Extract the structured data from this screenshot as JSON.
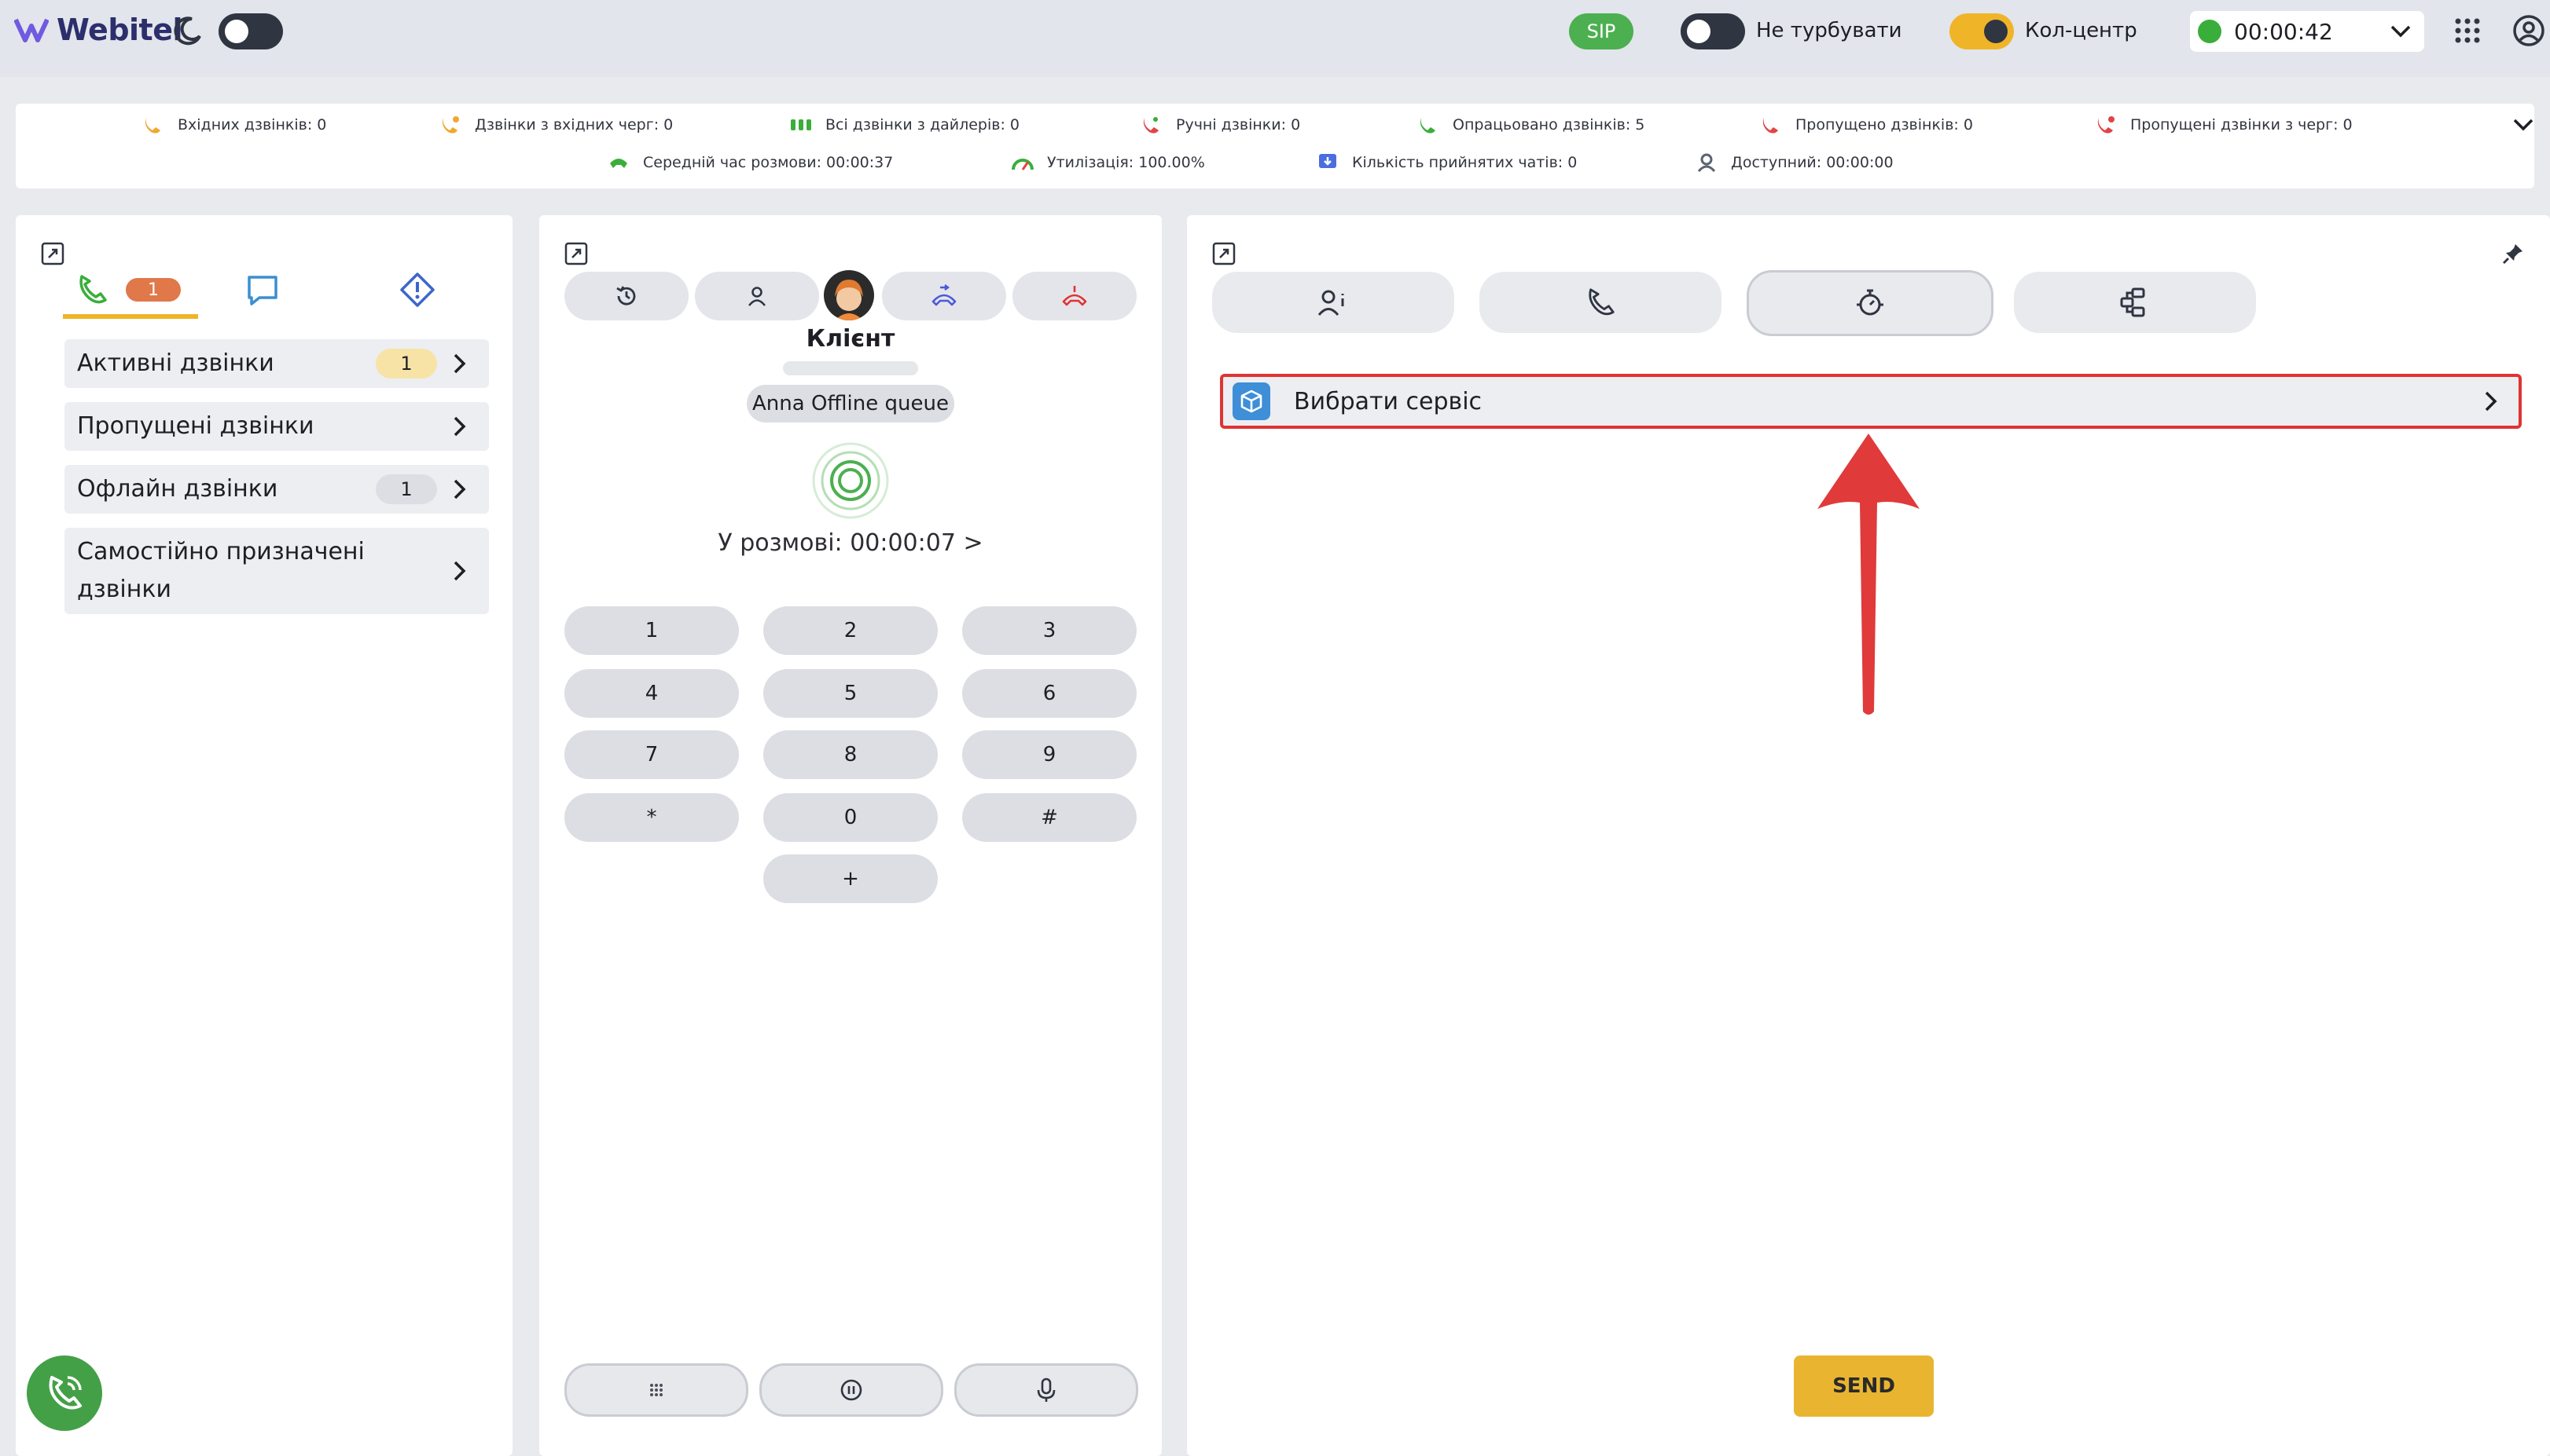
{
  "header": {
    "logo_text": "Webitel",
    "sip_label": "SIP",
    "dnd_label": "Не турбувати",
    "callcenter_label": "Кол-центр",
    "status_timer": "00:00:42"
  },
  "stats": [
    {
      "label": "Вхідних дзвінків: 0"
    },
    {
      "label": "Дзвінки з вхідних черг: 0"
    },
    {
      "label": "Всі дзвінки з дайлерів: 0"
    },
    {
      "label": "Ручні дзвінки: 0"
    },
    {
      "label": "Опрацьовано дзвінків: 5"
    },
    {
      "label": "Пропущено дзвінків: 0"
    },
    {
      "label": "Пропущені дзвінки з черг: 0"
    },
    {
      "label": "Середній час розмови: 00:00:37"
    },
    {
      "label": "Утилізація: 100.00%"
    },
    {
      "label": "Кількість прийнятих чатів: 0"
    },
    {
      "label": "Доступний: 00:00:00"
    }
  ],
  "left": {
    "calls_tab_badge": "1",
    "items": [
      {
        "label": "Активні дзвінки",
        "badge": "1"
      },
      {
        "label": "Пропущені дзвінки",
        "badge": ""
      },
      {
        "label": "Офлайн дзвінки",
        "badge": "1"
      },
      {
        "label": "Самостійно призначені дзвінки",
        "badge": ""
      }
    ]
  },
  "mid": {
    "contact_name": "Клієнт",
    "queue_name": "Anna Offline queue",
    "call_status": "У розмові: 00:00:07 >",
    "keys": [
      "1",
      "2",
      "3",
      "4",
      "5",
      "6",
      "7",
      "8",
      "9",
      "*",
      "0",
      "#",
      "+"
    ]
  },
  "right": {
    "service_label": "Вибрати сервіс",
    "send_label": "SEND"
  },
  "colors": {
    "accent_yellow": "#e9b531",
    "sip_green": "#4caf50",
    "hangup_red": "#e03333",
    "highlight_red": "#e03333",
    "brand_navy": "#2c2f6c"
  }
}
